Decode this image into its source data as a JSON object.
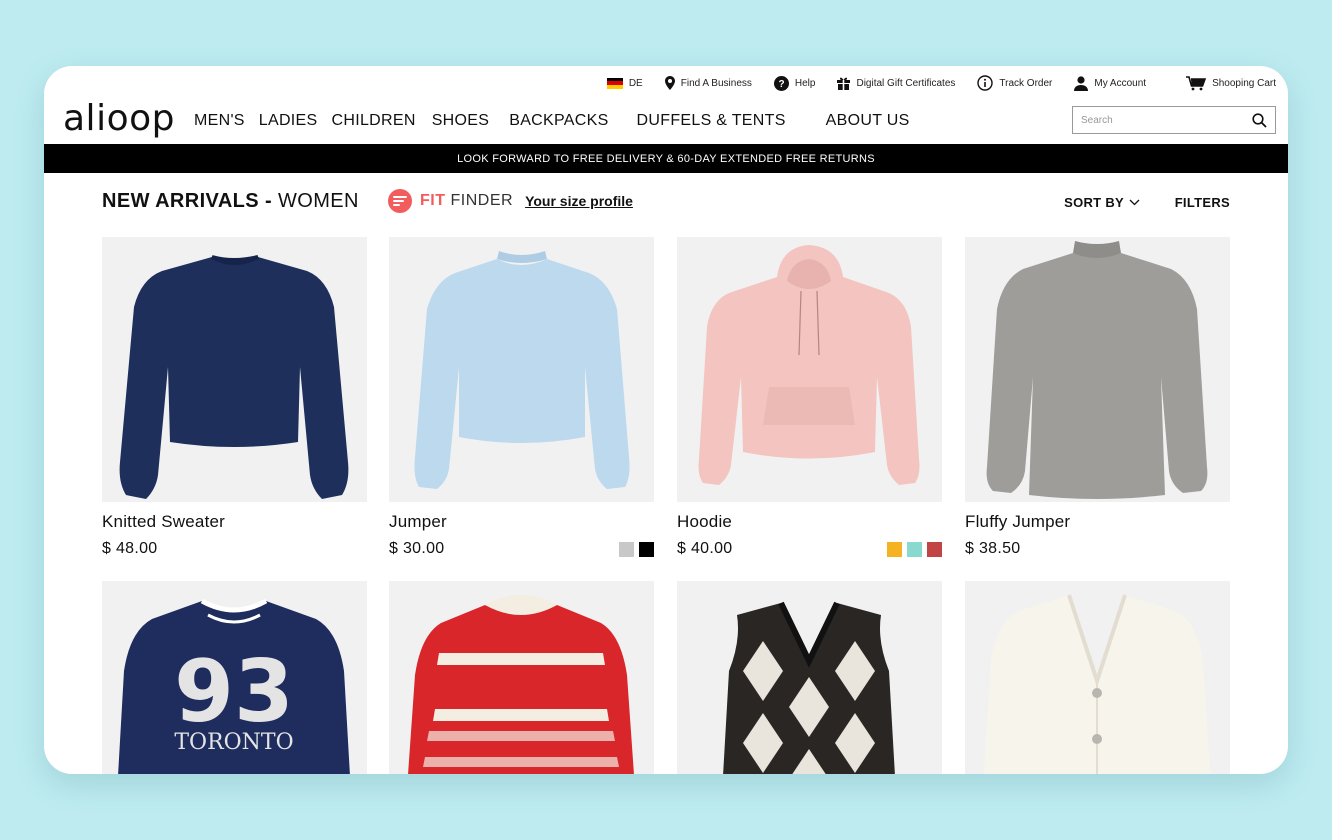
{
  "utility_bar": {
    "language": "DE",
    "find_business": "Find A Business",
    "help": "Help",
    "gift": "Digital Gift Certificates",
    "track": "Track Order",
    "account": "My Account",
    "cart": "Shooping Cart"
  },
  "header": {
    "logo": "alioop",
    "nav": [
      "MEN'S",
      "LADIES",
      "CHILDREN",
      "SHOES",
      "BACKPACKS",
      "DUFFELS & TENTS",
      "ABOUT US"
    ],
    "search_placeholder": "Search"
  },
  "banner": "LOOK FORWARD TO FREE DELIVERY & 60-DAY EXTENDED FREE RETURNS",
  "page": {
    "title_bold": "NEW ARRIVALS -",
    "title_light": "WOMEN",
    "fit_word": "FIT",
    "finder_word": "FINDER",
    "fit_link": "Your size profile",
    "sort_label": "SORT BY",
    "filters_label": "FILTERS"
  },
  "products": [
    {
      "name": "Knitted Sweater",
      "price": "$ 48.00",
      "swatches": []
    },
    {
      "name": "Jumper",
      "price": "$ 30.00",
      "swatches": [
        "#c8c8c8",
        "#000000"
      ]
    },
    {
      "name": "Hoodie",
      "price": "$ 40.00",
      "swatches": [
        "#f5b323",
        "#8ad9cf",
        "#c24545"
      ]
    },
    {
      "name": "Fluffy Jumper",
      "price": "$ 38.50",
      "swatches": []
    },
    {
      "print": {
        "number": "93",
        "city": "TORONTO"
      }
    },
    {},
    {},
    {}
  ],
  "colors": {
    "accent": "#f25c5c",
    "banner_bg": "#000000",
    "background": "#bdebf0"
  }
}
